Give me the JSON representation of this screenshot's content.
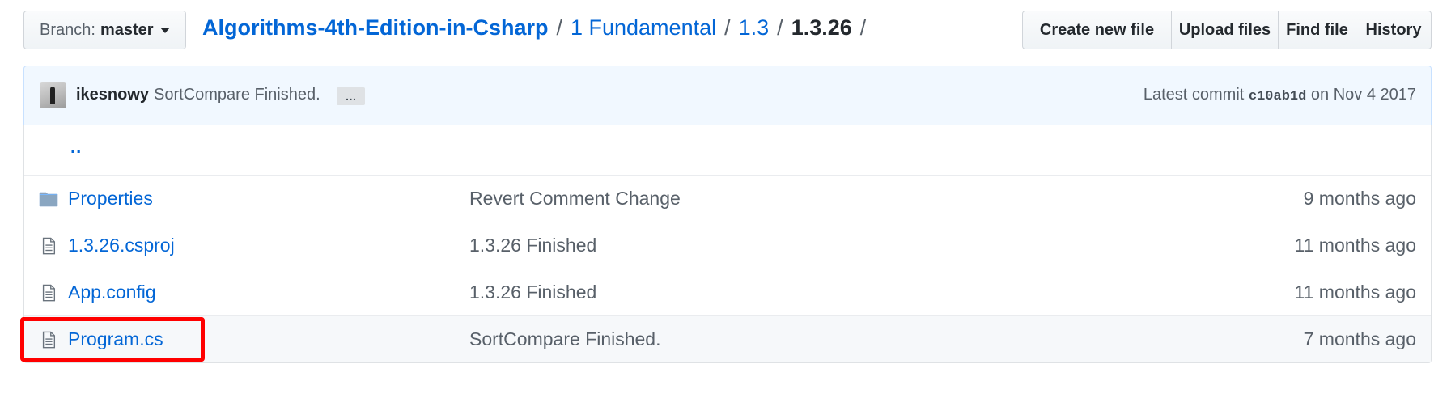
{
  "branch": {
    "prefix": "Branch:",
    "name": "master"
  },
  "breadcrumb": {
    "repo": "Algorithms-4th-Edition-in-Csharp",
    "separator": "/",
    "crumbs": [
      "1 Fundamental",
      "1.3"
    ],
    "current": "1.3.26"
  },
  "actions": {
    "create_new_file": "Create new file",
    "upload_files": "Upload files",
    "find_file": "Find file",
    "history": "History"
  },
  "commit": {
    "author": "ikesnowy",
    "message": "SortCompare Finished.",
    "ellipsis": "…",
    "latest_label": "Latest commit",
    "sha": "c10ab1d",
    "date_text": "on Nov 4 2017"
  },
  "files": {
    "parent_link": "..",
    "rows": [
      {
        "icon": "folder-icon",
        "name": "Properties",
        "message": "Revert Comment Change",
        "age": "9 months ago"
      },
      {
        "icon": "file-icon",
        "name": "1.3.26.csproj",
        "message": "1.3.26 Finished",
        "age": "11 months ago"
      },
      {
        "icon": "file-icon",
        "name": "App.config",
        "message": "1.3.26 Finished",
        "age": "11 months ago"
      },
      {
        "icon": "file-icon",
        "name": "Program.cs",
        "message": "SortCompare Finished.",
        "age": "7 months ago"
      }
    ]
  },
  "colors": {
    "link": "#0366d6",
    "muted": "#586069",
    "commit_bg": "#f1f8ff",
    "highlight_border": "#ff0000"
  }
}
